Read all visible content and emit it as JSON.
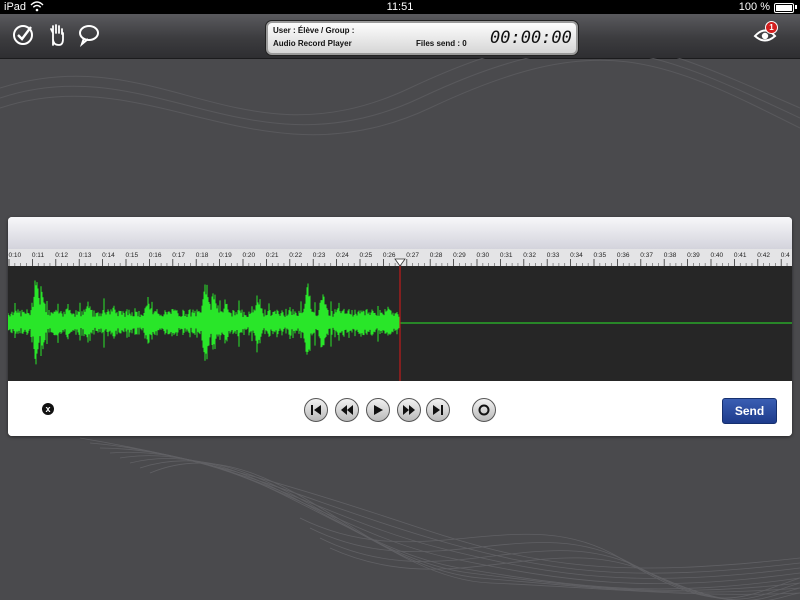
{
  "status_bar": {
    "carrier": "iPad",
    "time": "11:51",
    "battery": "100 %"
  },
  "toolbar": {
    "icons": [
      "check-icon",
      "hand-icon",
      "speech-bubble-icon"
    ],
    "info": {
      "user_label": "User : Élève / Group :",
      "app_name": "Audio Record Player",
      "files_sent": "Files send : 0",
      "timer": "00:00:00"
    },
    "eye_badge": "1"
  },
  "timeline": {
    "labels": [
      "0:10",
      "0:11",
      "0:12",
      "0:13",
      "0:14",
      "0:15",
      "0:16",
      "0:17",
      "0:18",
      "0:19",
      "0:20",
      "0:21",
      "0:22",
      "0:23",
      "0:24",
      "0:25",
      "0:26",
      "0:27",
      "0:28",
      "0:29",
      "0:30",
      "0:31",
      "0:32",
      "0:33",
      "0:34",
      "0:35",
      "0:36",
      "0:37",
      "0:38",
      "0:39",
      "0:40",
      "0:41",
      "0:42",
      "0:4"
    ],
    "playhead": "0:26",
    "playhead_fraction": 0.5
  },
  "controls": {
    "close_label": "x",
    "buttons": [
      "skip-to-start-icon",
      "rewind-icon",
      "play-icon",
      "fast-forward-icon",
      "skip-to-end-icon",
      "record-icon"
    ],
    "send_label": "Send"
  },
  "colors": {
    "waveform": "#29e629",
    "playhead": "#c01b1b",
    "send_button": "#24449a"
  }
}
